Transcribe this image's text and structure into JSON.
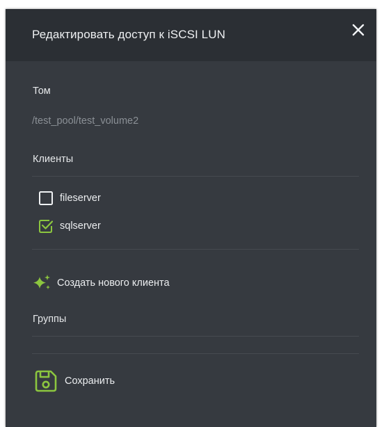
{
  "dialog": {
    "title": "Редактировать доступ к iSCSI LUN",
    "close_icon": "close-icon"
  },
  "volume": {
    "label": "Том",
    "value": "/test_pool/test_volume2"
  },
  "clients": {
    "label": "Клиенты",
    "items": [
      {
        "label": "fileserver",
        "checked": false
      },
      {
        "label": "sqlserver",
        "checked": true
      }
    ],
    "create_label": "Создать нового клиента",
    "create_icon": "sparkle-add-icon"
  },
  "groups": {
    "label": "Группы"
  },
  "footer": {
    "save_label": "Сохранить",
    "save_icon": "save-icon"
  },
  "colors": {
    "dialog_bg": "#363a40",
    "header_bg": "#2b2f34",
    "accent_green": "#8cc63f",
    "text": "#eceef0",
    "muted_text": "#8b9096",
    "divider": "#464a50"
  }
}
